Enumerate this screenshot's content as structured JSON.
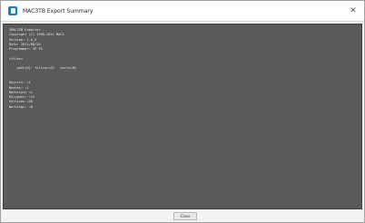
{
  "window": {
    "title": "MAC3TB Export Summary",
    "close_glyph": "✕",
    "app_icon": "app-icon"
  },
  "log": {
    "lines": [
      "IMAC3TB Exporter",
      "Copyright (C) 1998-2011 MAC3",
      "Version: 1.0.3",
      "Date: 2011/08/16",
      "Programmer: IP TK",
      "",
      "<files>",
      "",
      "    path[0]: fullcar=32   verts=30",
      "",
      "",
      "Objects: =1",
      "Meshes: =1",
      "Materials =1",
      "Polygons: =12",
      "Vertices =36",
      "Warnings: =0"
    ]
  },
  "footer": {
    "close_label": "Close"
  }
}
